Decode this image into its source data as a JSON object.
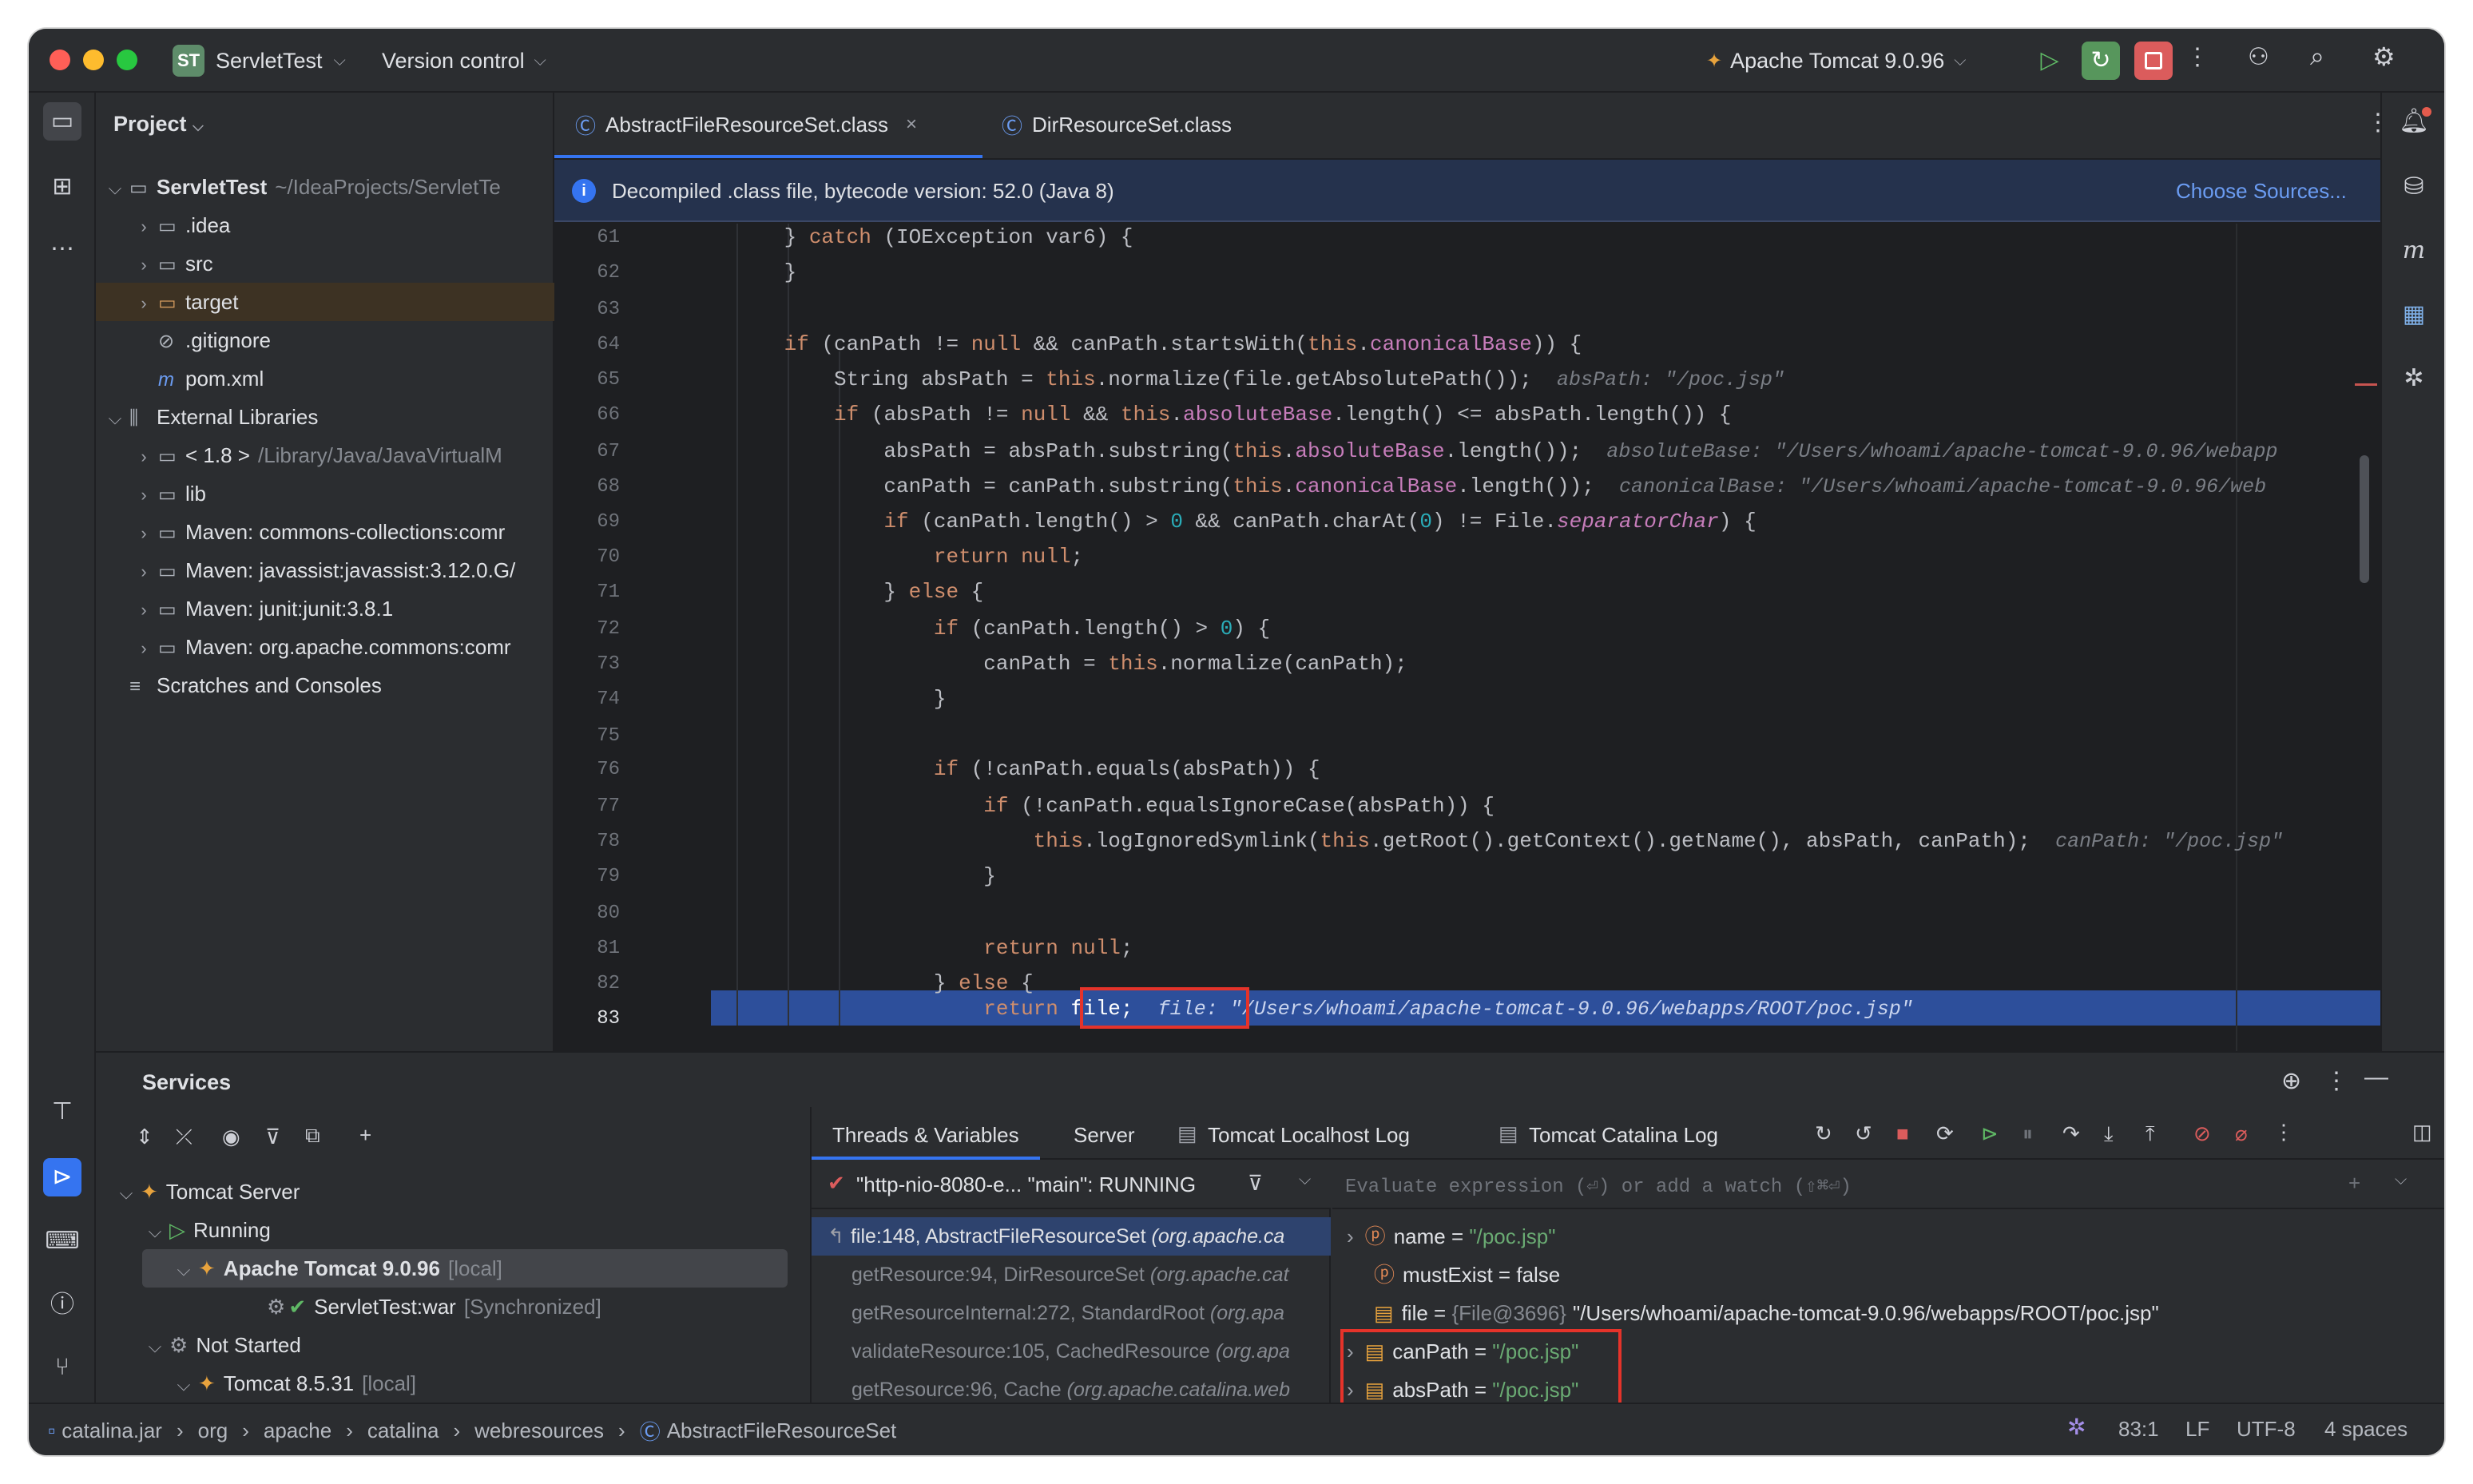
{
  "titlebar": {
    "project_badge": "ST",
    "project_name": "ServletTest",
    "vcs": "Version control",
    "run_config": "Apache Tomcat 9.0.96"
  },
  "project_panel": {
    "title": "Project",
    "items": [
      {
        "label": "ServletTest",
        "extra": "~/IdeaProjects/ServletTe"
      },
      {
        "label": ".idea"
      },
      {
        "label": "src"
      },
      {
        "label": "target"
      },
      {
        "label": ".gitignore"
      },
      {
        "label": "pom.xml"
      },
      {
        "label": "External Libraries"
      },
      {
        "label": "< 1.8 >",
        "extra": "/Library/Java/JavaVirtualM"
      },
      {
        "label": "lib"
      },
      {
        "label": "Maven: commons-collections:comr"
      },
      {
        "label": "Maven: javassist:javassist:3.12.0.G/"
      },
      {
        "label": "Maven: junit:junit:3.8.1"
      },
      {
        "label": "Maven: org.apache.commons:comr"
      },
      {
        "label": "Scratches and Consoles"
      }
    ]
  },
  "editor": {
    "tabs": [
      {
        "label": "AbstractFileResourceSet.class",
        "active": true
      },
      {
        "label": "DirResourceSet.class",
        "active": false
      }
    ],
    "banner": "Decompiled .class file, bytecode version: 52.0 (Java 8)",
    "banner_link": "Choose Sources...",
    "line_numbers": [
      "61",
      "62",
      "63",
      "64",
      "65",
      "66",
      "67",
      "68",
      "69",
      "70",
      "71",
      "72",
      "73",
      "74",
      "75",
      "76",
      "77",
      "78",
      "79",
      "80",
      "81",
      "82",
      "83"
    ],
    "hints": {
      "l65": "absPath: \"/poc.jsp\"",
      "l67": "absoluteBase: \"/Users/whoami/apache-tomcat-9.0.96/webapp",
      "l68": "canonicalBase: \"/Users/whoami/apache-tomcat-9.0.96/web",
      "l78": "canPath: \"/poc.jsp\"",
      "l83": "file: \"/Users/whoami/apache-tomcat-9.0.96/webapps/ROOT/poc.jsp\""
    }
  },
  "services": {
    "title": "Services",
    "tree": [
      {
        "label": "Tomcat Server"
      },
      {
        "label": "Running"
      },
      {
        "label": "Apache Tomcat 9.0.96",
        "extra": "[local]"
      },
      {
        "label": "ServletTest:war",
        "extra": "[Synchronized]"
      },
      {
        "label": "Not Started"
      },
      {
        "label": "Tomcat 8.5.31",
        "extra": "[local]"
      }
    ],
    "tabs": [
      "Threads & Variables",
      "Server",
      "Tomcat Localhost Log",
      "Tomcat Catalina Log"
    ],
    "thread": "\"http-nio-8080-e... \"main\": RUNNING",
    "eval_placeholder": "Evaluate expression (⏎) or add a watch (⇧⌘⏎)",
    "frames": [
      {
        "loc": "file:148, AbstractFileResourceSet",
        "cls": "(org.apache.ca"
      },
      {
        "loc": "getResource:94, DirResourceSet",
        "cls": "(org.apache.cat"
      },
      {
        "loc": "getResourceInternal:272, StandardRoot",
        "cls": "(org.apa"
      },
      {
        "loc": "validateResource:105, CachedResource",
        "cls": "(org.apa"
      },
      {
        "loc": "getResource:96, Cache",
        "cls": "(org.apache.catalina.web"
      }
    ],
    "variables": [
      {
        "name": "name",
        "eq": " = ",
        "value": "\"/poc.jsp\""
      },
      {
        "name": "mustExist",
        "eq": " = ",
        "value": "false"
      },
      {
        "name": "file",
        "eq": " = ",
        "type": "{File@3696}",
        "value": "\"/Users/whoami/apache-tomcat-9.0.96/webapps/ROOT/poc.jsp\""
      },
      {
        "name": "canPath",
        "eq": " = ",
        "value": "\"/poc.jsp\""
      },
      {
        "name": "absPath",
        "eq": " = ",
        "value": "\"/poc.jsp\""
      }
    ]
  },
  "statusbar": {
    "crumbs": [
      "catalina.jar",
      "org",
      "apache",
      "catalina",
      "webresources",
      "AbstractFileResourceSet"
    ],
    "position": "83:1",
    "line_sep": "LF",
    "encoding": "UTF-8",
    "indent": "4 spaces"
  },
  "colors": {
    "accent": "#3574f0",
    "highlight_line": "#2d4f9b",
    "annotation": "#e5332a"
  }
}
